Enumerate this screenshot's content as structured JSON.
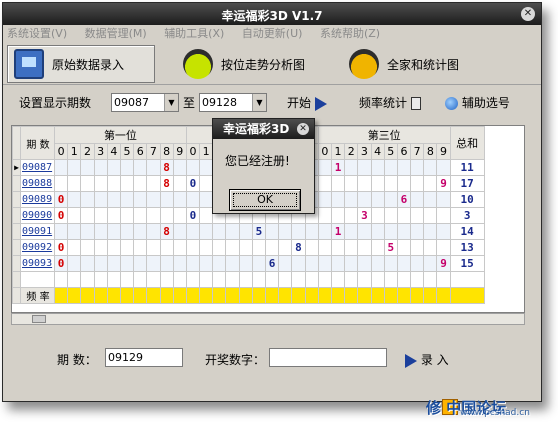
{
  "window": {
    "title": "幸运福彩3D V1.7"
  },
  "menu": [
    "系统设置(V)",
    "数据管理(M)",
    "辅助工具(X)",
    "自动更新(U)",
    "系统帮助(Z)"
  ],
  "toolbar": {
    "btn1": "原始数据录入",
    "btn2": "按位走势分析图",
    "btn3": "全家和统计图"
  },
  "settings": {
    "label": "设置显示期数",
    "from": "09087",
    "to_label": "至",
    "to": "09128",
    "start": "开始",
    "freq": "频率统计",
    "assist": "辅助选号"
  },
  "grid": {
    "col_period": "期 数",
    "col_first": "第一位",
    "col_third": "第三位",
    "col_sum": "总和",
    "digits": [
      "0",
      "1",
      "2",
      "3",
      "4",
      "5",
      "6",
      "7",
      "8",
      "9"
    ],
    "rows": [
      {
        "period": "09087",
        "sum": "11"
      },
      {
        "period": "09088",
        "sum": "17"
      },
      {
        "period": "09089",
        "sum": "10"
      },
      {
        "period": "09090",
        "sum": "3"
      },
      {
        "period": "09091",
        "sum": "14"
      },
      {
        "period": "09092",
        "sum": "13"
      },
      {
        "period": "09093",
        "sum": "15"
      }
    ],
    "freq_label": "频 率"
  },
  "bottom": {
    "period_label": "期   数：",
    "period_value": "09129",
    "digits_label": "开奖数字：",
    "digits_value": "",
    "enter": "录  入"
  },
  "dialog": {
    "title": "幸运福彩3D",
    "message": "您已经注册!",
    "ok": "OK"
  },
  "watermark": {
    "text": "修 中国论坛",
    "url": "www.pcshad.cn"
  }
}
